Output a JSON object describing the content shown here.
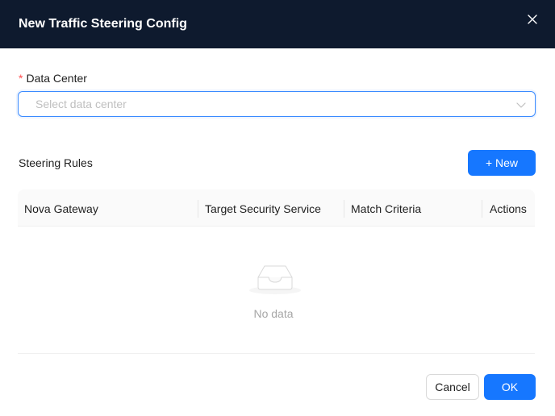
{
  "modal": {
    "title": "New Traffic Steering Config",
    "close_icon": "close-icon"
  },
  "form": {
    "data_center": {
      "required_mark": "*",
      "label": "Data Center",
      "placeholder": "Select data center",
      "chevron_icon": "chevron-down-icon"
    }
  },
  "rules": {
    "title": "Steering Rules",
    "new_button_label": "+ New",
    "columns": [
      "Nova Gateway",
      "Target Security Service",
      "Match Criteria",
      "Actions"
    ],
    "rows": [],
    "empty_text": "No data",
    "empty_icon": "empty-inbox-icon"
  },
  "footer": {
    "cancel_label": "Cancel",
    "ok_label": "OK"
  },
  "colors": {
    "header_bg": "#0e1a2e",
    "primary": "#1677ff",
    "required": "#ff4d4f",
    "placeholder": "#bfbfbf"
  }
}
